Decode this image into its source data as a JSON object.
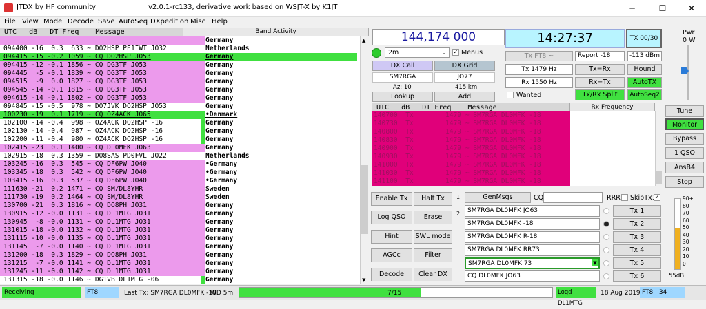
{
  "window": {
    "title_left": "JTDX  by HF community",
    "title_center": "v2.0.1-rc133, derivative work based on WSJT-X by K1JT",
    "min": "─",
    "max": "☐",
    "close": "✕"
  },
  "menu": [
    "File",
    "View",
    "Mode",
    "Decode",
    "Save",
    "AutoSeq",
    "DXpedition",
    "Misc",
    "Help"
  ],
  "band": {
    "header": " UTC   dB   DT Freq    Message",
    "activity_label": "Band Activity",
    "rows": [
      {
        "m": "",
        "c": "Germany",
        "bg": "#ec9aec",
        "mk": "#ec9aec"
      },
      {
        "m": "094400 -16  0.3  633 ~ DO2HSP PE1IWT JO32",
        "c": "Netherlands",
        "bg": "#fff",
        "mk": "#fff"
      },
      {
        "m": "094415 -15 -0.2 1059 ~ CQ DO2HSP JO53",
        "c": "Germany",
        "bg": "#40e040",
        "mk": "#40e040",
        "cbg": "#40e040",
        "under": true
      },
      {
        "m": "094415 -12 -0.1 1856 ~ CQ DG3TF JO53",
        "c": "Germany",
        "bg": "#ec9aec",
        "mk": "#ec9aec"
      },
      {
        "m": "094445  -5 -0.1 1839 ~ CQ DG3TF JO53",
        "c": "Germany",
        "bg": "#ec9aec",
        "mk": "#ec9aec"
      },
      {
        "m": "094515  -9  0.0 1827 ~ CQ DG3TF JO53",
        "c": "Germany",
        "bg": "#ec9aec",
        "mk": "#ec9aec"
      },
      {
        "m": "094545 -14 -0.1 1815 ~ CQ DG3TF JO53",
        "c": "Germany",
        "bg": "#ec9aec",
        "mk": "#ec9aec"
      },
      {
        "m": "094615 -14 -0.1 1802 ~ CQ DG3TF JO53",
        "c": "Germany",
        "bg": "#ec9aec",
        "mk": "#ec9aec"
      },
      {
        "m": "094845 -15 -0.5  978 ~ DO7JVK DO2HSP JO53",
        "c": "Germany",
        "bg": "#fff",
        "mk": "#fff"
      },
      {
        "m": "100230 -19  0.1 1719 ~ CQ OZ4ACK JO65",
        "c": "•Denmark",
        "bg": "#40e040",
        "mk": "#40e040",
        "cbg": "#fff",
        "under": true
      },
      {
        "m": "102100 -14 -0.4  998 ~ OZ4ACK DO2HSP -16",
        "c": "Germany",
        "bg": "#fff",
        "mk": "#40e040"
      },
      {
        "m": "102130 -14 -0.4  987 ~ OZ4ACK DO2HSP -16",
        "c": "Germany",
        "bg": "#fff",
        "mk": "#40e040"
      },
      {
        "m": "102200 -11 -0.4  980 ~ OZ4ACK DO2HSP -16",
        "c": "Germany",
        "bg": "#fff",
        "mk": "#40e040"
      },
      {
        "m": "102415 -23  0.1 1400 ~ CQ DL0MFK JO63",
        "c": "Germany",
        "bg": "#ec9aec",
        "mk": "#ec9aec"
      },
      {
        "m": "102915 -18  0.3 1359 ~ DO8SAS PD0FVL JO22",
        "c": "Netherlands",
        "bg": "#fff",
        "mk": "#fff"
      },
      {
        "m": "103245 -16  0.3  545 ~ CQ DF6PW JO40",
        "c": "•Germany",
        "bg": "#ec9aec",
        "mk": "#ec9aec"
      },
      {
        "m": "103345 -18  0.3  542 ~ CQ DF6PW JO40",
        "c": "•Germany",
        "bg": "#ec9aec",
        "mk": "#ec9aec"
      },
      {
        "m": "103415 -16  0.3  537 ~ CQ DF6PW JO40",
        "c": "•Germany",
        "bg": "#ec9aec",
        "mk": "#ec9aec"
      },
      {
        "m": "111630 -21  0.2 1471 ~ CQ SM/DL8YHR",
        "c": "Sweden",
        "bg": "#ec9aec",
        "mk": "#ec9aec"
      },
      {
        "m": "111730 -19  0.2 1464 ~ CQ SM/DL8YHR",
        "c": "Sweden",
        "bg": "#ec9aec",
        "mk": "#ec9aec"
      },
      {
        "m": "130700 -21  0.3 1816 ~ CQ DO8PH JO31",
        "c": "Germany",
        "bg": "#ec9aec",
        "mk": "#ec9aec"
      },
      {
        "m": "130915 -12 -0.0 1131 ~ CQ DL1MTG JO31",
        "c": "Germany",
        "bg": "#ec9aec",
        "mk": "#ec9aec"
      },
      {
        "m": "130945  -8 -0.0 1131 ~ CQ DL1MTG JO31",
        "c": "Germany",
        "bg": "#ec9aec",
        "mk": "#ec9aec"
      },
      {
        "m": "131015 -18 -0.0 1132 ~ CQ DL1MTG JO31",
        "c": "Germany",
        "bg": "#ec9aec",
        "mk": "#ec9aec"
      },
      {
        "m": "131115 -10 -0.0 1135 ~ CQ DL1MTG JO31",
        "c": "Germany",
        "bg": "#ec9aec",
        "mk": "#ec9aec"
      },
      {
        "m": "131145  -7 -0.0 1140 ~ CQ DL1MTG JO31",
        "c": "Germany",
        "bg": "#ec9aec",
        "mk": "#ec9aec"
      },
      {
        "m": "131200 -18  0.3 1829 ~ CQ DO8PH JO31",
        "c": "Germany",
        "bg": "#ec9aec",
        "mk": "#ec9aec"
      },
      {
        "m": "131215  -7 -0.0 1141 ~ CQ DL1MTG JO31",
        "c": "Germany",
        "bg": "#ec9aec",
        "mk": "#ec9aec"
      },
      {
        "m": "131245 -11 -0.0 1142 ~ CQ DL1MTG JO31",
        "c": "Germany",
        "bg": "#ec9aec",
        "mk": "#ec9aec"
      },
      {
        "m": "131315 -18 -0.0 1146 ~ DG1VB DL1MTG -06",
        "c": "Germany",
        "bg": "#fff",
        "mk": "#40e040"
      }
    ]
  },
  "dial": {
    "freq": "144,174 000",
    "band": "2m",
    "menus_label": "Menus"
  },
  "dx": {
    "call_btn": "DX Call",
    "grid_btn": "DX Grid",
    "call": "SM7RGA",
    "grid": "JO77",
    "az": "Az: 10",
    "dist": "415 km",
    "lookup": "Lookup",
    "add": "Add"
  },
  "clock": {
    "time": "14:27:37",
    "tx_period": "TX 00/30"
  },
  "txctl": {
    "txft8": "Tx FT8 ~",
    "report": "Report -18",
    "dbm": "-113 dBm",
    "tx_label": "Tx  1479  Hz",
    "txeqrx": "Tx=Rx",
    "hound": "Hound",
    "rx_label": "Rx  1550  Hz",
    "rxeqtx": "Rx=Tx",
    "autotx": "AutoTX",
    "wanted": "Wanted",
    "split": "Tx/Rx Split",
    "autoseq2": "AutoSeq2"
  },
  "pwr": {
    "label": "Pwr",
    "value": "0 W"
  },
  "rx": {
    "header": " UTC   dB   DT Freq    Message",
    "label": "Rx Frequency",
    "rows": [
      "140700  Tx        1479 ~ SM7RGA DL0MFK -18",
      "140730  Tx        1479 ~ SM7RGA DL0MFK -18",
      "140800  Tx        1479 ~ SM7RGA DL0MFK -18",
      "140830  Tx        1479 ~ SM7RGA DL0MFK -18",
      "140900  Tx        1479 ~ SM7RGA DL0MFK -18",
      "140930  Tx        1479 ~ SM7RGA DL0MFK -18",
      "141000  Tx        1479 ~ SM7RGA DL0MFK -18",
      "141030  Tx        1479 ~ SM7RGA DL0MFK -18",
      "141100  Tx        1479 ~ SM7RGA DL0MFK -18"
    ]
  },
  "side": {
    "tune": "Tune",
    "monitor": "Monitor",
    "bypass": "Bypass",
    "one_qso": "1 QSO",
    "ansb4": "AnsB4",
    "stop": "Stop"
  },
  "ctrl": {
    "enable_tx": "Enable Tx",
    "halt_tx": "Halt Tx",
    "log_qso": "Log QSO",
    "erase": "Erase",
    "hint": "Hint",
    "swl": "SWL mode",
    "agcc": "AGCc",
    "filter": "Filter",
    "decode": "Decode",
    "clear_dx": "Clear DX"
  },
  "gen": {
    "tab1": "1",
    "tab2": "2",
    "genmsgs": "GenMsgs",
    "cq": "CQ",
    "rrr": "RRR",
    "skiptx1": "SkipTx1"
  },
  "tx": {
    "messages": [
      "SM7RGA DL0MFK JO63",
      "SM7RGA DL0MFK -18",
      "SM7RGA DL0MFK R-18",
      "SM7RGA DL0MFK RR73",
      "SM7RGA DL0MFK 73",
      "CQ DL0MFK JO63"
    ],
    "buttons": [
      "Tx 1",
      "Tx 2",
      "Tx 3",
      "Tx 4",
      "Tx 5",
      "Tx 6"
    ],
    "selected": 2
  },
  "meter": {
    "ticks": [
      "90+",
      "80",
      "70",
      "60",
      "50",
      "40",
      "30",
      "20",
      "10",
      "0"
    ],
    "level_percent": 58,
    "readout": "55dB"
  },
  "status": {
    "receiving": "Receiving",
    "mode": "FT8",
    "last_tx": "Last Tx: SM7RGA DL0MFK -18",
    "wd": "WD 5m",
    "progress": "7/15",
    "progress_percent": 58,
    "logd": "Logd DL1MTG",
    "date": "18 Aug 2019",
    "mode_count": "FT8   34"
  },
  "colors": {
    "green": "#40e040",
    "pink": "#ec9aec",
    "tx_red": "#e0007a",
    "clock_bg": "#b8f4ff"
  }
}
